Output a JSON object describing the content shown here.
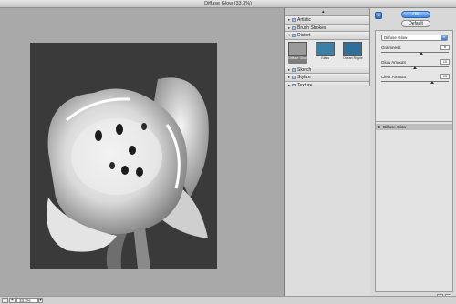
{
  "window": {
    "title": "Diffuse Glow (33.3%)"
  },
  "status": {
    "zoom_out": "-",
    "zoom_in": "+",
    "zoom_value": "33.3%",
    "zoom_arrow": "▾"
  },
  "gallery": {
    "folders_top": [
      {
        "label": "Artistic",
        "expanded": false
      },
      {
        "label": "Brush Strokes",
        "expanded": false
      },
      {
        "label": "Distort",
        "expanded": true
      }
    ],
    "thumbs": [
      {
        "label": "Diffuse Glow",
        "selected": true,
        "color": "#9a9a9a"
      },
      {
        "label": "Glass",
        "selected": false,
        "color": "#3d7fa6"
      },
      {
        "label": "Ocean Ripple",
        "selected": false,
        "color": "#2f6f9a"
      }
    ],
    "folders_bottom": [
      {
        "label": "Sketch",
        "expanded": false
      },
      {
        "label": "Stylize",
        "expanded": false
      },
      {
        "label": "Texture",
        "expanded": false
      }
    ],
    "collapse_icon": "chevron-up-icon"
  },
  "side": {
    "toggle_label": "◂",
    "ok_label": "OK",
    "default_label": "Default",
    "filter_select": "Diffuse Glow",
    "params": [
      {
        "label": "Graininess",
        "value": "6",
        "fraction": 0.6
      },
      {
        "label": "Glow Amount",
        "value": "10",
        "fraction": 0.5
      },
      {
        "label": "Clear Amount",
        "value": "15",
        "fraction": 0.75
      }
    ],
    "layer_label": "Diffuse Glow",
    "new_layer_icon": "new-layer-icon",
    "delete_layer_icon": "trash-icon"
  },
  "colors": {
    "accent": "#3f86e0",
    "canvas_bg": "#a9a9a9",
    "photo_bg": "#3a3a3a"
  }
}
